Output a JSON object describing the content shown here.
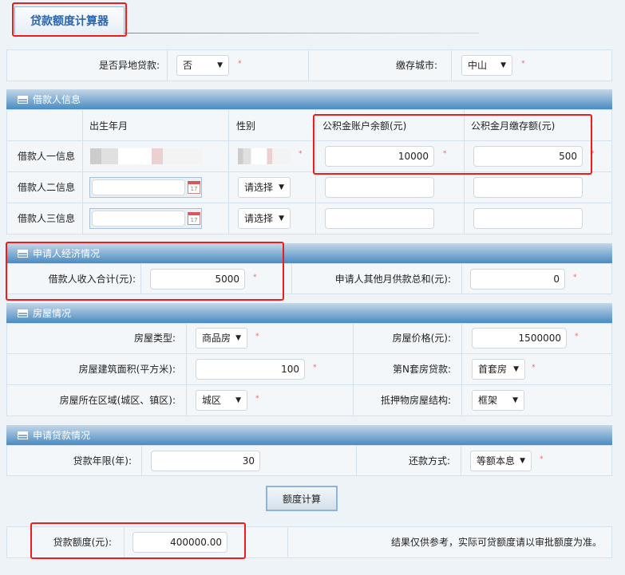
{
  "tab": {
    "title": "贷款额度计算器"
  },
  "top": {
    "remote_label": "是否异地贷款:",
    "remote_value": "否",
    "city_label": "缴存城市:",
    "city_value": "中山",
    "required": "*"
  },
  "borrower": {
    "section": "借款人信息",
    "headers": [
      "出生年月",
      "性别",
      "公积金账户余额(元)",
      "公积金月缴存额(元)"
    ],
    "rows": [
      {
        "label": "借款人一信息",
        "gender": "",
        "balance": "10000",
        "monthly": "500"
      },
      {
        "label": "借款人二信息",
        "gender": "请选择",
        "balance": "",
        "monthly": ""
      },
      {
        "label": "借款人三信息",
        "gender": "请选择",
        "balance": "",
        "monthly": ""
      }
    ]
  },
  "economy": {
    "section": "申请人经济情况",
    "income_label": "借款人收入合计(元):",
    "income_value": "5000",
    "other_label": "申请人其他月供款总和(元):",
    "other_value": "0"
  },
  "house": {
    "section": "房屋情况",
    "type_label": "房屋类型:",
    "type_value": "商品房",
    "price_label": "房屋价格(元):",
    "price_value": "1500000",
    "area_label": "房屋建筑面积(平方米):",
    "area_value": "100",
    "nth_label": "第N套房贷款:",
    "nth_value": "首套房",
    "region_label": "房屋所在区域(城区、镇区):",
    "region_value": "城区",
    "struct_label": "抵押物房屋结构:",
    "struct_value": "框架"
  },
  "loan": {
    "section": "申请贷款情况",
    "years_label": "贷款年限(年):",
    "years_value": "30",
    "method_label": "还款方式:",
    "method_value": "等额本息"
  },
  "calc_button": "额度计算",
  "result": {
    "label": "贷款额度(元):",
    "value": "400000.00",
    "note": "结果仅供参考，实际可贷额度请以审批额度为准。"
  }
}
